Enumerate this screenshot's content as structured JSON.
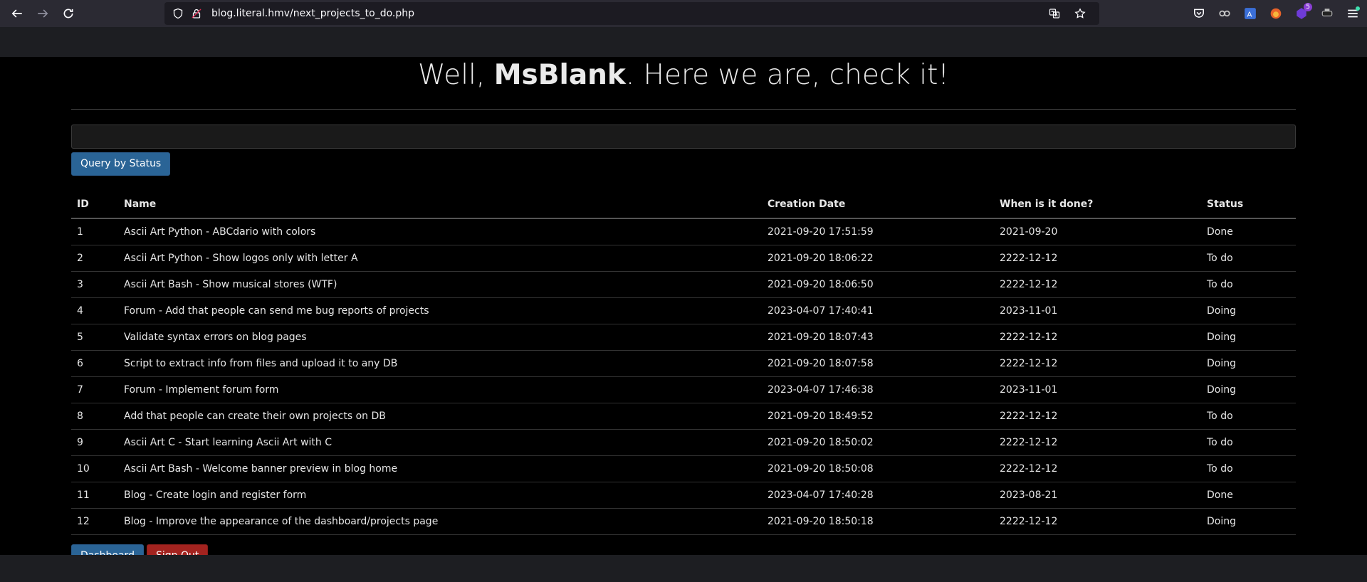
{
  "browser": {
    "url": "blog.literal.hmv/next_projects_to_do.php",
    "extension_badge": "5"
  },
  "page": {
    "heading_prefix": "Well, ",
    "heading_user": "MsBlank",
    "heading_suffix": ". Here we are, check it!",
    "search_value": "",
    "query_button": "Query by Status",
    "dashboard_button": "Dashboard",
    "signout_button": "Sign Out"
  },
  "table": {
    "headers": [
      "ID",
      "Name",
      "Creation Date",
      "When is it done?",
      "Status"
    ],
    "rows": [
      [
        "1",
        "Ascii Art Python - ABCdario with colors",
        "2021-09-20 17:51:59",
        "2021-09-20",
        "Done"
      ],
      [
        "2",
        "Ascii Art Python - Show logos only with letter A",
        "2021-09-20 18:06:22",
        "2222-12-12",
        "To do"
      ],
      [
        "3",
        "Ascii Art Bash - Show musical stores (WTF)",
        "2021-09-20 18:06:50",
        "2222-12-12",
        "To do"
      ],
      [
        "4",
        "Forum - Add that people can send me bug reports of projects",
        "2023-04-07 17:40:41",
        "2023-11-01",
        "Doing"
      ],
      [
        "5",
        "Validate syntax errors on blog pages",
        "2021-09-20 18:07:43",
        "2222-12-12",
        "Doing"
      ],
      [
        "6",
        "Script to extract info from files and upload it to any DB",
        "2021-09-20 18:07:58",
        "2222-12-12",
        "Doing"
      ],
      [
        "7",
        "Forum - Implement forum form",
        "2023-04-07 17:46:38",
        "2023-11-01",
        "Doing"
      ],
      [
        "8",
        "Add that people can create their own projects on DB",
        "2021-09-20 18:49:52",
        "2222-12-12",
        "To do"
      ],
      [
        "9",
        "Ascii Art C - Start learning Ascii Art with C",
        "2021-09-20 18:50:02",
        "2222-12-12",
        "To do"
      ],
      [
        "10",
        "Ascii Art Bash - Welcome banner preview in blog home",
        "2021-09-20 18:50:08",
        "2222-12-12",
        "To do"
      ],
      [
        "11",
        "Blog - Create login and register form",
        "2023-04-07 17:40:28",
        "2023-08-21",
        "Done"
      ],
      [
        "12",
        "Blog - Improve the appearance of the dashboard/projects page",
        "2021-09-20 18:50:18",
        "2222-12-12",
        "Doing"
      ]
    ]
  }
}
